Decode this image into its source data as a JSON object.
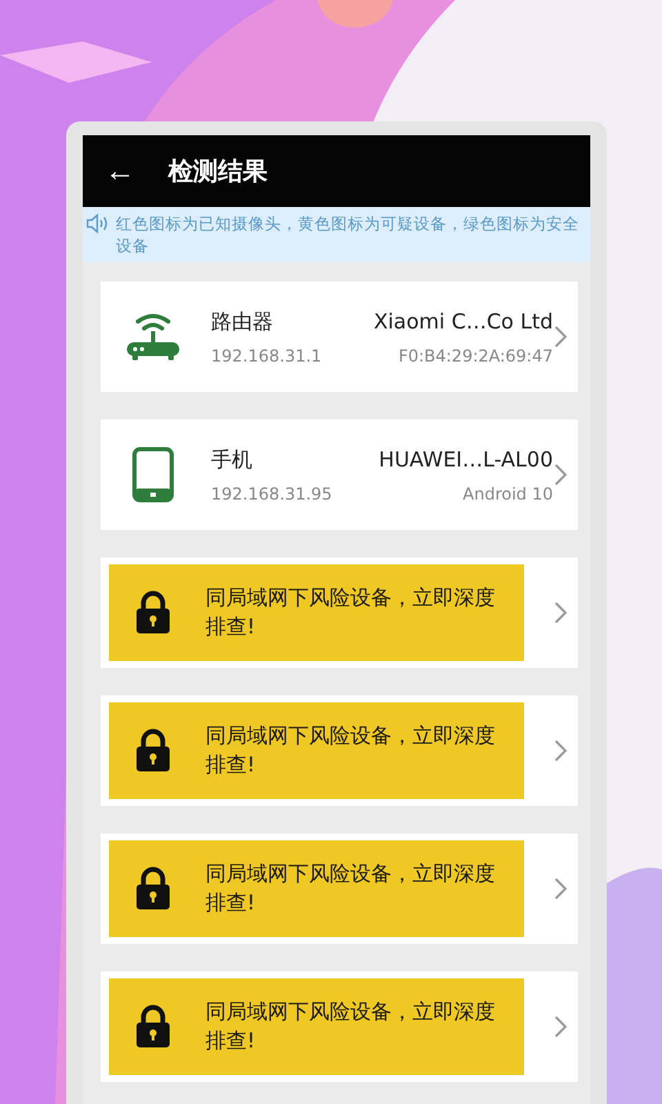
{
  "header": {
    "back": "←",
    "title": "检测结果"
  },
  "notice": "红色图标为已知摄像头，黄色图标为可疑设备，绿色图标为安全设备",
  "items": [
    {
      "kind": "router",
      "name": "路由器",
      "ip": "192.168.31.1",
      "vendor": "Xiaomi C…Co Ltd",
      "detail": "F0:B4:29:2A:69:47"
    },
    {
      "kind": "phone",
      "name": "手机",
      "ip": "192.168.31.95",
      "vendor": "HUAWEI…L-AL00",
      "detail": "Android 10"
    },
    {
      "kind": "locked",
      "text": "同局域网下风险设备，立即深度排查!"
    },
    {
      "kind": "locked",
      "text": "同局域网下风险设备，立即深度排查!"
    },
    {
      "kind": "locked",
      "text": "同局域网下风险设备，立即深度排查!"
    },
    {
      "kind": "locked",
      "text": "同局域网下风险设备，立即深度排查!"
    }
  ]
}
